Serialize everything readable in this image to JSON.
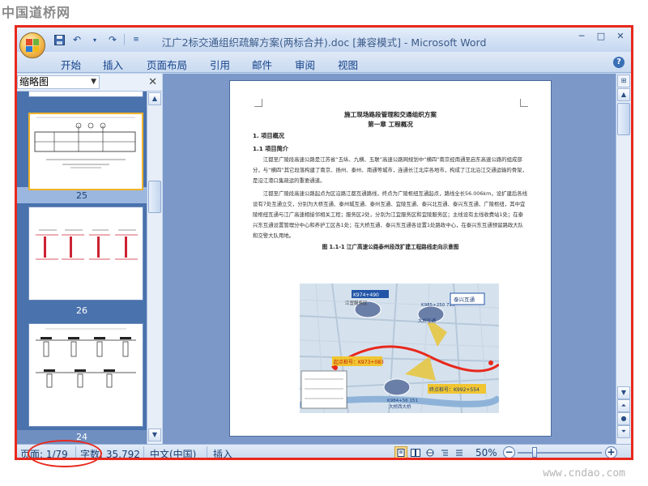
{
  "watermarks": {
    "top_left": "中国道桥网",
    "bottom_right": "www.cndao.com"
  },
  "window": {
    "title": "江广2标交通组织疏解方案(两标合并).doc [兼容模式] - Microsoft Word"
  },
  "ribbon": {
    "tabs": [
      "开始",
      "插入",
      "页面布局",
      "引用",
      "邮件",
      "审阅",
      "视图"
    ]
  },
  "thumbnail_pane": {
    "dropdown_value": "缩略图",
    "pages": [
      {
        "label": "25",
        "selected": true
      },
      {
        "label": "26",
        "selected": false
      },
      {
        "label": "24",
        "selected": false
      }
    ]
  },
  "document": {
    "heading1": "施工现场路段管理和交通组织方案",
    "chapter": "第一章  工程概况",
    "section1": "1. 项目概况",
    "section11": "1.1 项目简介",
    "para1": "江都至广陵段高速公路是江苏省“五纵、九横、五联”高速公路网规划中“横四”南京经南通至启东高速公路的组成部分，与“横四”其它段落构建了南京、扬州、泰州、南通等城市，连通长江北岸各地市，构成了江北沿江交通运输的骨架，是沿江港口集疏运的重要通道。",
    "para2": "江都至广陵段高速公路起点为区沿路江都互通路线，终点为广陵枢纽互通起点，路线全长56.006km，设扩建后各线设有7处互通立交，分别为大桥互通、泰州城互通、泰州互通、宜陵互通、泰兴北互通、泰兴东互通、广陵枢纽，其中宜陵枢纽互通与江广高速相接邻相关工程；服务区2处，分别为江宜服务区和宜陵服务区；主线设有主线收费站1处；在泰兴东互通设置管理分中心和养护工区各1处；在大桥互通、泰兴东互通各设置1处路政中心，在泰兴东互通预留路政大队和交警大队用地。",
    "figure_caption": "图 1.1-1  江广高速公路泰州段改扩建工程路线走向示意图",
    "map_labels": {
      "top_box": "K974+490",
      "service": "江宜服务区",
      "right_box": "K985+250 715",
      "interchange": "泰兴互通",
      "start": "起点桩号：K973+083",
      "end": "终点桩号：K992+554",
      "bottom": "K984+56 151",
      "bridge": "大桥互通",
      "bottom_town": "大桥西大桥"
    }
  },
  "statusbar": {
    "page": "页面: 1/79",
    "words": "字数: 35,792",
    "language": "中文(中国)",
    "mode": "插入",
    "zoom": "50%",
    "zoom_percent": 50
  },
  "colors": {
    "annotation_red": "#e8281c",
    "ribbon_blue": "#c6d7ee",
    "pane_blue": "#4a72ad",
    "doc_bg": "#7b98c8"
  }
}
